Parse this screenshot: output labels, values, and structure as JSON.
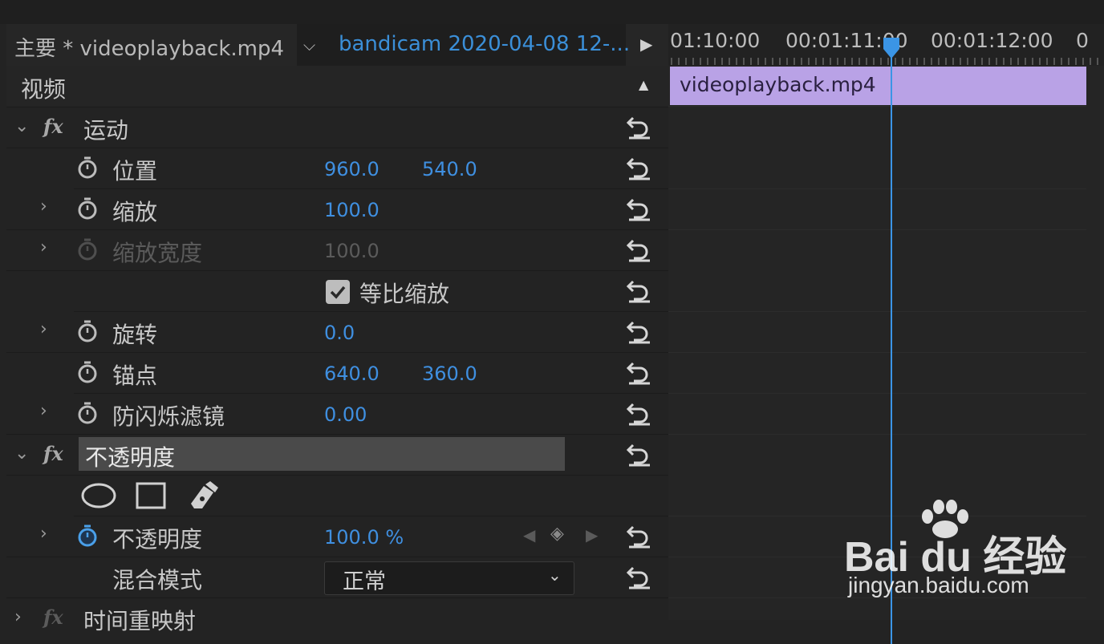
{
  "header": {
    "main_label": "主要 * videoplayback.mp4",
    "clip_label": "bandicam 2020-04-08 12-...",
    "dropdown_icon": "chevron-down-icon",
    "play_icon": "play-triangle-icon"
  },
  "video_section": {
    "label": "视频",
    "collapse_icon": "triangle-up-icon"
  },
  "motion": {
    "label": "运动",
    "fx": "fx",
    "properties": {
      "position": {
        "label": "位置",
        "x": "960.0",
        "y": "540.0"
      },
      "scale": {
        "label": "缩放",
        "value": "100.0"
      },
      "scale_width": {
        "label": "缩放宽度",
        "value": "100.0"
      },
      "uniform_scale": {
        "label": "等比缩放",
        "checked": true
      },
      "rotation": {
        "label": "旋转",
        "value": "0.0"
      },
      "anchor": {
        "label": "锚点",
        "x": "640.0",
        "y": "360.0"
      },
      "anti_flicker": {
        "label": "防闪烁滤镜",
        "value": "0.00"
      }
    }
  },
  "opacity": {
    "label": "不透明度",
    "fx": "fx",
    "mask_tools": [
      "ellipse-mask-icon",
      "rectangle-mask-icon",
      "pen-mask-icon"
    ],
    "opacity_prop": {
      "label": "不透明度",
      "value": "100.0 %"
    },
    "blend_mode": {
      "label": "混合模式",
      "value": "正常"
    }
  },
  "time_remap": {
    "label": "时间重映射",
    "fx": "fx"
  },
  "timeline": {
    "timecodes": [
      "01:10:00",
      "00:01:11:00",
      "00:01:12:00",
      "0"
    ],
    "clip_name": "videoplayback.mp4",
    "clip_color": "#b9a2e6",
    "playhead_color": "#3b95e6"
  },
  "watermark": {
    "brand": "Bai du 经验",
    "url": "jingyan.baidu.com"
  },
  "colors": {
    "value_blue": "#3f8fe0",
    "panel_bg": "#232323"
  }
}
